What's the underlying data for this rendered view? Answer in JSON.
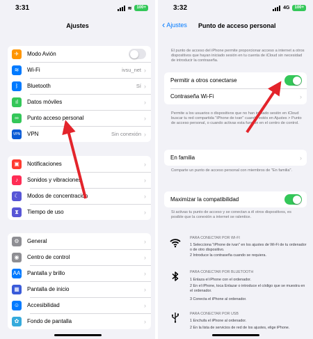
{
  "left": {
    "time": "3:31",
    "battery": "100+",
    "title": "Ajustes",
    "group1": [
      {
        "icon": "airplane-icon",
        "color": "#ff9500",
        "glyph": "✈",
        "label": "Modo Avión",
        "toggle": true
      },
      {
        "icon": "wifi-icon",
        "color": "#007aff",
        "glyph": "≋",
        "label": "Wi-Fi",
        "value": "ivsu_net"
      },
      {
        "icon": "bluetooth-icon",
        "color": "#007aff",
        "glyph": "ᛒ",
        "label": "Bluetooth",
        "value": "Sí"
      },
      {
        "icon": "cellular-icon",
        "color": "#34c759",
        "glyph": "ıl",
        "label": "Datos móviles",
        "value": ""
      },
      {
        "icon": "hotspot-icon",
        "color": "#34c759",
        "glyph": "∞",
        "label": "Punto acceso personal",
        "value": ""
      },
      {
        "icon": "vpn-icon",
        "color": "#0a5bd6",
        "glyph": "VPN",
        "label": "VPN",
        "value": "Sin conexión"
      }
    ],
    "group2": [
      {
        "icon": "notifications-icon",
        "color": "#ff3b30",
        "glyph": "▣",
        "label": "Notificaciones"
      },
      {
        "icon": "sounds-icon",
        "color": "#ff2d55",
        "glyph": "♪",
        "label": "Sonidos y vibraciones"
      },
      {
        "icon": "focus-icon",
        "color": "#5856d6",
        "glyph": "☾",
        "label": "Modos de concentración"
      },
      {
        "icon": "screen-time-icon",
        "color": "#5856d6",
        "glyph": "⧗",
        "label": "Tiempo de uso"
      }
    ],
    "group3": [
      {
        "icon": "general-icon",
        "color": "#8e8e93",
        "glyph": "⚙",
        "label": "General"
      },
      {
        "icon": "control-center-icon",
        "color": "#8e8e93",
        "glyph": "◉",
        "label": "Centro de control"
      },
      {
        "icon": "display-icon",
        "color": "#007aff",
        "glyph": "AA",
        "label": "Pantalla y brillo"
      },
      {
        "icon": "home-screen-icon",
        "color": "#3a5bd9",
        "glyph": "▦",
        "label": "Pantalla de inicio"
      },
      {
        "icon": "accessibility-icon",
        "color": "#007aff",
        "glyph": "☺",
        "label": "Accesibilidad"
      },
      {
        "icon": "wallpaper-icon",
        "color": "#35aadc",
        "glyph": "✿",
        "label": "Fondo de pantalla"
      }
    ]
  },
  "right": {
    "time": "3:32",
    "network": "4G",
    "battery": "100+",
    "back_label": "Ajustes",
    "title": "Punto de acceso personal",
    "intro": "El punto de acceso del iPhone permite proporcionar acceso a internet a otros dispositivos que hayan iniciado sesión en tu cuenta de iCloud sin necesidad de introducir la contraseña.",
    "allow_label": "Permitir a otros conectarse",
    "wifi_password_label": "Contraseña Wi-Fi",
    "allow_note": "Permite a los usuarios o dispositivos que no han iniciado sesión en iCloud buscar tu red compartida \"iPhone de ivan\" cuando estés en Ajustes > Punto de acceso personal, o cuando activas esta función en el centro de control.",
    "family_label": "En familia",
    "family_note": "Comparte un punto de acceso personal con miembros de \"En familia\".",
    "maximize_label": "Maximizar la compatibilidad",
    "maximize_note": "Si activas tu punto de acceso y se conectan a él otros dispositivos, es posible que la conexión a internet se ralentice.",
    "wifi_section": {
      "header": "PARA CONECTAR POR WI-FI",
      "steps": [
        "1 Selecciona \"iPhone de ivan\" en los ajustes de Wi-Fi de tu ordenador o de otro dispositivo.",
        "2 Introduce la contraseña cuando se requiera."
      ]
    },
    "bt_section": {
      "header": "PARA CONECTAR POR BLUETOOTH",
      "steps": [
        "1 Enlaza el iPhone con el ordenador.",
        "2 En el iPhone, toca Enlazar o introduce el código que se muestra en el ordenador.",
        "3 Conecta el iPhone al ordenador."
      ]
    },
    "usb_section": {
      "header": "PARA CONECTAR POR USB",
      "steps": [
        "1 Enchufa el iPhone al ordenador.",
        "2 En la lista de servicios de red de los ajustes, elige iPhone."
      ]
    }
  },
  "colors": {
    "accent": "#007aff",
    "toggle_on": "#34c759",
    "annotation_arrow": "#e3242b"
  }
}
